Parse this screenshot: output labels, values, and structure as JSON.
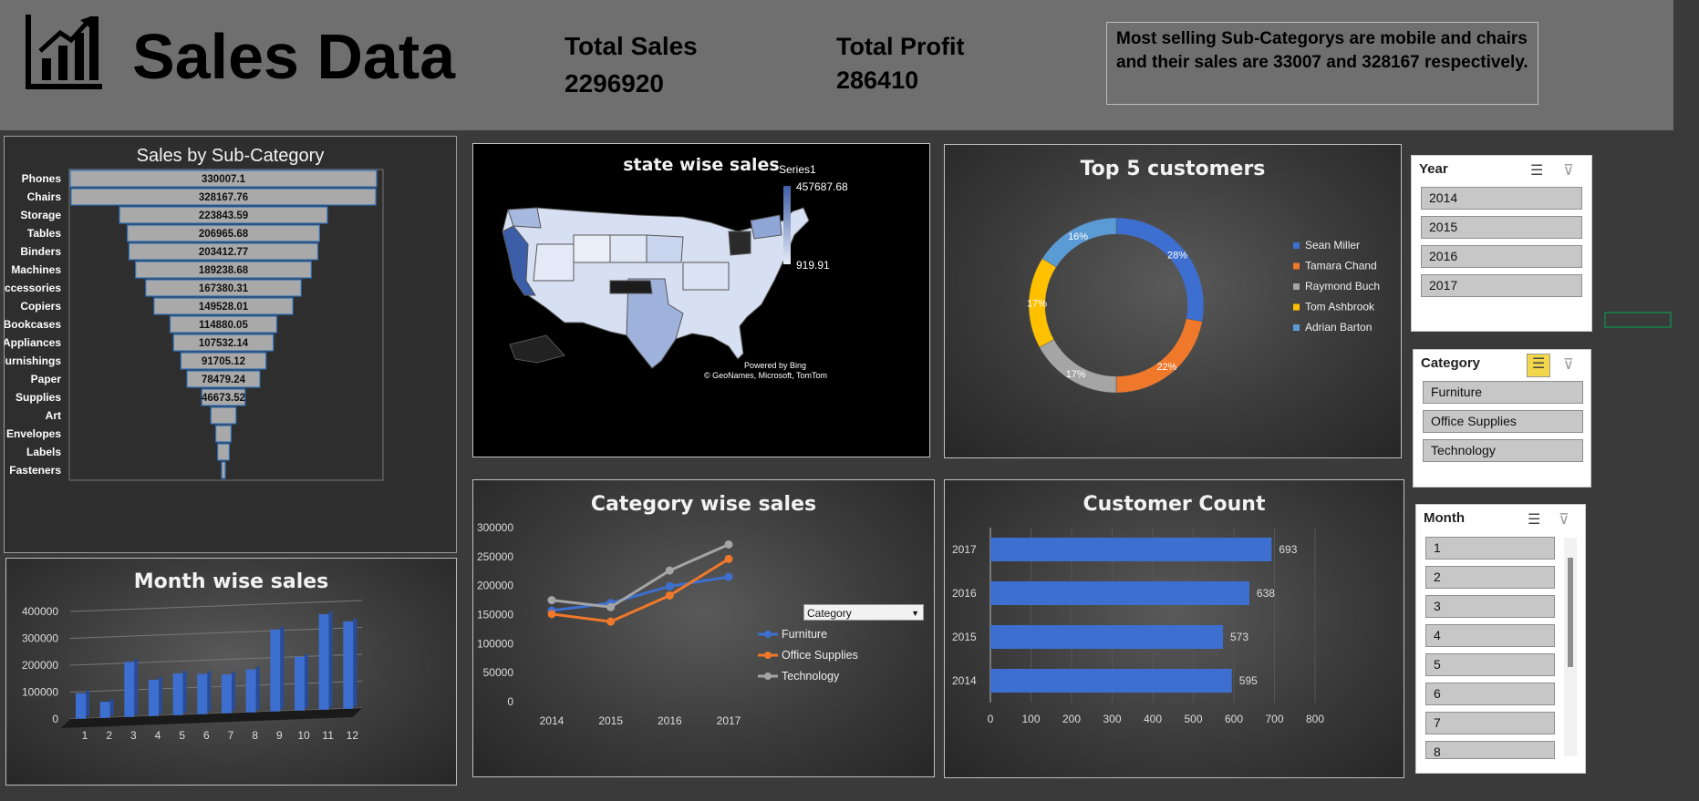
{
  "header": {
    "title": "Sales Data",
    "total_sales_label": "Total Sales",
    "total_sales_value": "2296920",
    "total_profit_label": "Total Profit",
    "total_profit_value": "286410",
    "note": "Most selling Sub-Categorys are mobile and chairs and their sales are 33007 and 328167 respectively."
  },
  "colors": {
    "header_bg": "#6f6f6f",
    "accent_blue": "#3d6fd0",
    "orange": "#f0782a",
    "gray": "#a5a5a5",
    "yellow": "#ffc000",
    "light_blue": "#5b9bd5"
  },
  "funnel": {
    "title": "Sales by Sub-Category",
    "chart_data": {
      "type": "bar",
      "categories": [
        "Phones",
        "Chairs",
        "Storage",
        "Tables",
        "Binders",
        "Machines",
        "Accessories",
        "Copiers",
        "Bookcases",
        "Appliances",
        "Furnishings",
        "Paper",
        "Supplies",
        "Art",
        "Envelopes",
        "Labels",
        "Fasteners"
      ],
      "values": [
        330007.1,
        328167.76,
        223843.59,
        206965.68,
        203412.77,
        189238.68,
        167380.31,
        149528.01,
        114880.05,
        107532.14,
        91705.12,
        78479.24,
        46673.52,
        27119,
        16476,
        12486,
        3024
      ],
      "labels": [
        "330007.1",
        "328167.76",
        "223843.59",
        "206965.68",
        "203412.77",
        "189238.68",
        "167380.31",
        "149528.01",
        "114880.05",
        "107532.14",
        "91705.12",
        "78479.24",
        "46673.52",
        "",
        "",
        "",
        ""
      ]
    }
  },
  "map": {
    "title": "state wise sales",
    "legend_series": "Series1",
    "legend_max": "457687.68",
    "legend_min": "919.91",
    "credit_1": "Powered by Bing",
    "credit_2": "© GeoNames, Microsoft, TomTom"
  },
  "donut": {
    "title": "Top 5 customers",
    "chart_data": {
      "type": "pie",
      "categories": [
        "Sean Miller",
        "Tamara Chand",
        "Raymond Buch",
        "Tom Ashbrook",
        "Adrian Barton"
      ],
      "values": [
        28,
        22,
        17,
        17,
        16
      ],
      "labels": [
        "28%",
        "22%",
        "17%",
        "17%",
        "16%"
      ],
      "colors": [
        "#3d6fd0",
        "#f0782a",
        "#a5a5a5",
        "#ffc000",
        "#5b9bd5"
      ]
    }
  },
  "month_chart": {
    "title": "Month wise sales",
    "chart_data": {
      "type": "bar",
      "categories": [
        "1",
        "2",
        "3",
        "4",
        "5",
        "6",
        "7",
        "8",
        "9",
        "10",
        "11",
        "12"
      ],
      "values": [
        95000,
        60000,
        205000,
        135000,
        155000,
        150000,
        145000,
        160000,
        305000,
        200000,
        355000,
        325000
      ],
      "ylim": [
        0,
        400000
      ],
      "yticks": [
        "0",
        "100000",
        "200000",
        "300000",
        "400000"
      ]
    }
  },
  "category_chart": {
    "title": "Category wise sales",
    "legend_header": "Category",
    "chart_data": {
      "type": "line",
      "x": [
        "2014",
        "2015",
        "2016",
        "2017"
      ],
      "series": [
        {
          "name": "Furniture",
          "values": [
            157000,
            170000,
            199000,
            215000
          ],
          "color": "#3d6fd0"
        },
        {
          "name": "Office Supplies",
          "values": [
            151000,
            138000,
            183000,
            246000
          ],
          "color": "#f0782a"
        },
        {
          "name": "Technology",
          "values": [
            175000,
            163000,
            226000,
            271000
          ],
          "color": "#a5a5a5"
        }
      ],
      "ylim": [
        0,
        300000
      ],
      "yticks": [
        "0",
        "50000",
        "100000",
        "150000",
        "200000",
        "250000",
        "300000"
      ]
    }
  },
  "customer_chart": {
    "title": "Customer Count",
    "chart_data": {
      "type": "bar",
      "categories": [
        "2017",
        "2016",
        "2015",
        "2014"
      ],
      "values": [
        693,
        638,
        573,
        595
      ],
      "labels": [
        "693",
        "638",
        "573",
        "595"
      ],
      "xlim": [
        0,
        800
      ],
      "xticks": [
        "0",
        "100",
        "200",
        "300",
        "400",
        "500",
        "600",
        "700",
        "800"
      ]
    }
  },
  "slicers": {
    "year": {
      "title": "Year",
      "items": [
        "2014",
        "2015",
        "2016",
        "2017"
      ]
    },
    "category": {
      "title": "Category",
      "items": [
        "Furniture",
        "Office Supplies",
        "Technology"
      ]
    },
    "month": {
      "title": "Month",
      "items": [
        "1",
        "2",
        "3",
        "4",
        "5",
        "6",
        "7",
        "8"
      ]
    }
  }
}
